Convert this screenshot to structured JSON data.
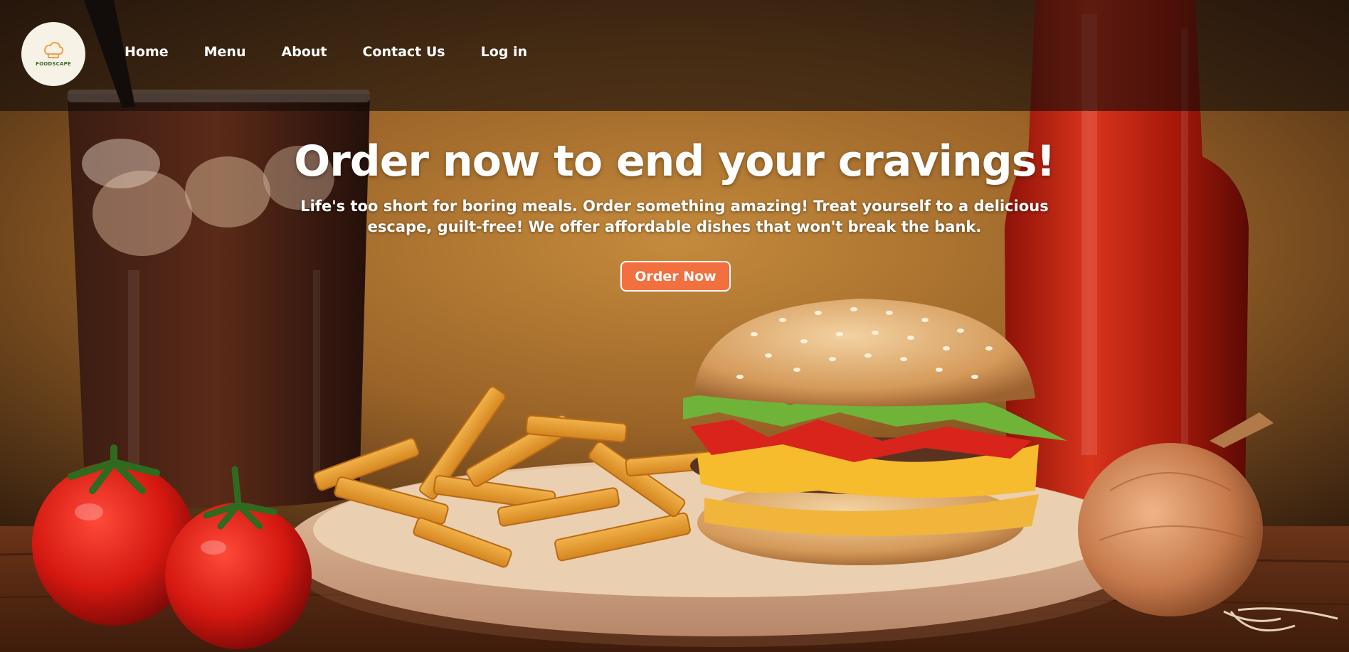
{
  "brand": {
    "logo_text": "FOODSCAPE"
  },
  "nav": {
    "items": [
      {
        "label": "Home"
      },
      {
        "label": "Menu"
      },
      {
        "label": "About"
      },
      {
        "label": "Contact Us"
      },
      {
        "label": "Log in"
      }
    ]
  },
  "hero": {
    "title": "Order now to end your cravings!",
    "subtitle": "Life's too short for boring meals. Order something amazing! Treat yourself to a delicious escape, guilt-free! We offer affordable dishes that won't break the bank.",
    "cta_label": "Order Now"
  },
  "colors": {
    "accent": "#f26f3f",
    "text": "#ffffff",
    "navbar_overlay": "#140c08"
  },
  "icons": {
    "logo": "chef-hat-icon"
  }
}
